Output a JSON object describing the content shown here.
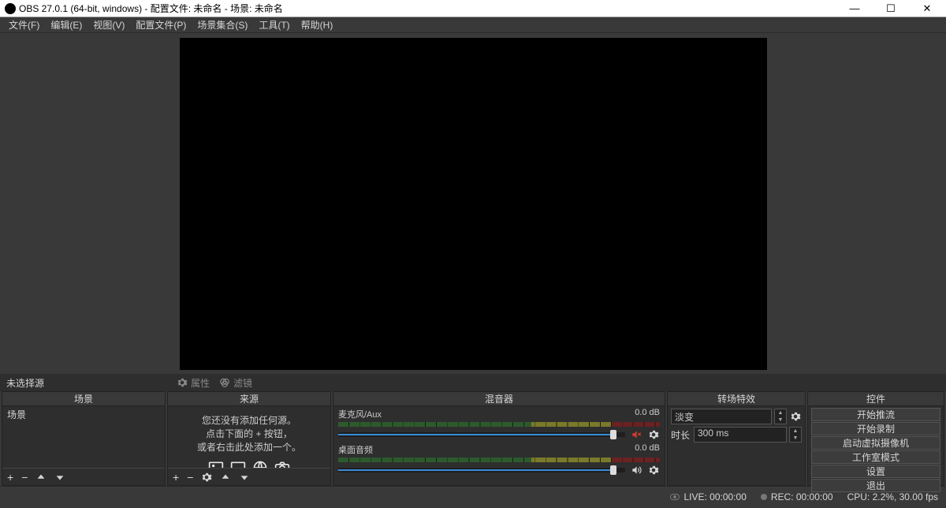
{
  "window": {
    "title": "OBS 27.0.1 (64-bit, windows) - 配置文件: 未命名 - 场景: 未命名"
  },
  "menus": {
    "file": "文件(F)",
    "edit": "编辑(E)",
    "view": "视图(V)",
    "profile": "配置文件(P)",
    "scene_collection": "场景集合(S)",
    "tools": "工具(T)",
    "help": "帮助(H)"
  },
  "toolstrip": {
    "no_source": "未选择源",
    "properties": "属性",
    "filters": "滤镜"
  },
  "docks": {
    "scenes": {
      "title": "场景",
      "items": [
        "场景"
      ]
    },
    "sources": {
      "title": "来源",
      "empty_line1": "您还没有添加任何源。",
      "empty_line2": "点击下面的 + 按钮，",
      "empty_line3": "或者右击此处添加一个。"
    },
    "mixer": {
      "title": "混音器",
      "channels": [
        {
          "name": "麦克风/Aux",
          "db": "0.0 dB",
          "muted": true
        },
        {
          "name": "桌面音频",
          "db": "0.0 dB",
          "muted": false
        }
      ]
    },
    "transitions": {
      "title": "转场特效",
      "selected": "淡变",
      "duration_label": "时长",
      "duration_value": "300 ms"
    },
    "controls": {
      "title": "控件",
      "buttons": {
        "stream": "开始推流",
        "record": "开始录制",
        "vcam": "启动虚拟摄像机",
        "studio": "工作室模式",
        "settings": "设置",
        "exit": "退出"
      }
    }
  },
  "status": {
    "live": "LIVE: 00:00:00",
    "rec": "REC: 00:00:00",
    "cpu": "CPU: 2.2%, 30.00 fps"
  }
}
